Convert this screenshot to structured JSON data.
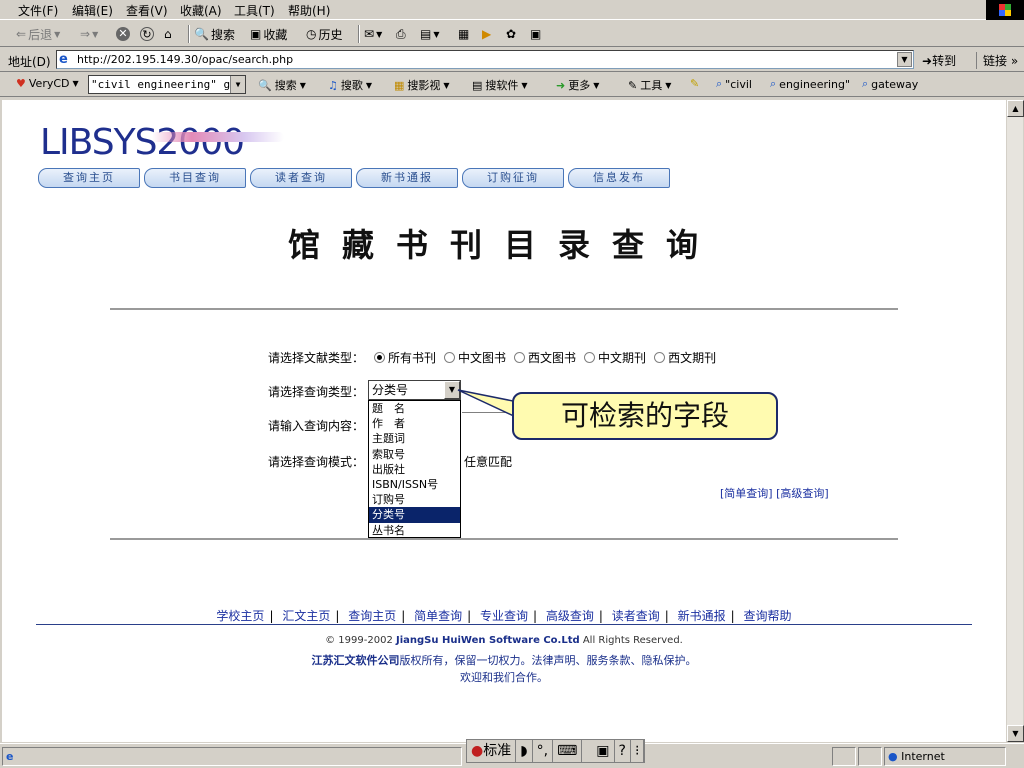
{
  "menubar": {
    "items": [
      "文件(F)",
      "编辑(E)",
      "查看(V)",
      "收藏(A)",
      "工具(T)",
      "帮助(H)"
    ]
  },
  "toolbar": {
    "back": "后退",
    "search": "搜索",
    "favorites": "收藏",
    "history": "历史"
  },
  "address": {
    "label": "地址(D)",
    "url": "http://202.195.149.30/opac/search.php",
    "go": "转到",
    "links": "链接 »"
  },
  "linkbar": {
    "verycd": "VeryCD",
    "combo_value": "\"civil engineering\" ga",
    "search": "搜索",
    "music": "搜歌",
    "video": "搜影视",
    "software": "搜软件",
    "more": "更多",
    "tools": "工具",
    "q1": "\"civil",
    "q2": "engineering\"",
    "q3": "gateway"
  },
  "site": {
    "logo": "LIBSYS2000",
    "nav": [
      "查询主页",
      "书目查询",
      "读者查询",
      "新书通报",
      "订购征询",
      "信息发布"
    ],
    "title": "馆藏书刊目录查询"
  },
  "form": {
    "doc_type_label": "请选择文献类型：",
    "doc_types": [
      {
        "label": "所有书刊",
        "checked": true
      },
      {
        "label": "中文图书",
        "checked": false
      },
      {
        "label": "西文图书",
        "checked": false
      },
      {
        "label": "中文期刊",
        "checked": false
      },
      {
        "label": "西文期刊",
        "checked": false
      }
    ],
    "query_type_label": "请选择查询类型：",
    "query_type_value": "分类号",
    "query_type_options": [
      "题　名",
      "作　者",
      "主题词",
      "索取号",
      "出版社",
      "ISBN/ISSN号",
      "订购号",
      "分类号",
      "丛书名"
    ],
    "query_type_selected_index": 7,
    "content_label": "请输入查询内容：",
    "mode_label": "请选择查询模式：",
    "mode_value": "任意匹配",
    "links": "[简单查询] [高级查询]"
  },
  "callout": {
    "text": "可检索的字段"
  },
  "footer": {
    "links": [
      "学校主页",
      "汇文主页",
      "查询主页",
      "简单查询",
      "专业查询",
      "高级查询",
      "读者查询",
      "新书通报",
      "查询帮助"
    ],
    "copyright_prefix": "© 1999-2002 ",
    "copyright_company": "JiangSu HuiWen Software Co.Ltd",
    "copyright_suffix": " All Rights Reserved.",
    "rights_company": "江苏汇文软件公司",
    "rights_text": "版权所有，保留一切权力。法律声明、服务条款、隐私保护。",
    "welcome": "欢迎和我们合作。"
  },
  "statusbar": {
    "zone": "Internet",
    "ime_mode": "标准"
  }
}
